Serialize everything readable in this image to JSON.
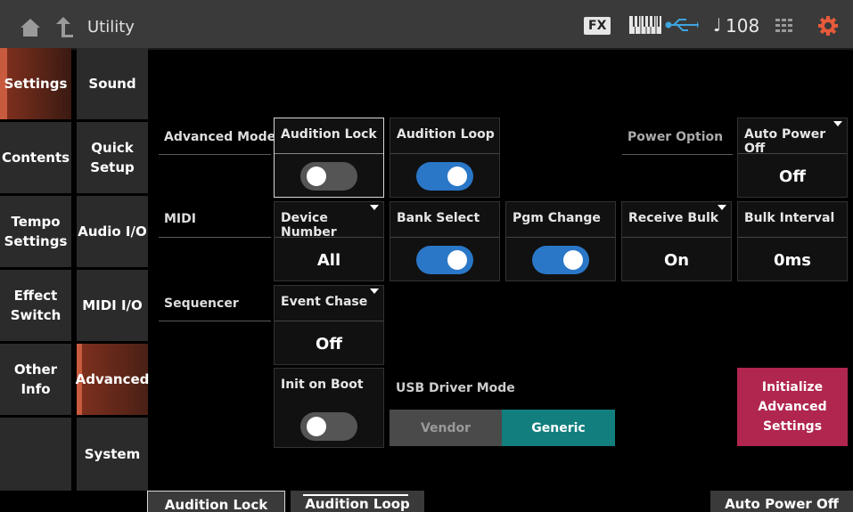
{
  "header": {
    "title": "Utility",
    "fx_label": "FX",
    "tempo": "♩08",
    "tempo_value": "108"
  },
  "nav_main": [
    {
      "label": "Settings"
    },
    {
      "label": "Contents"
    },
    {
      "label": "Tempo Settings"
    },
    {
      "label": "Effect Switch"
    },
    {
      "label": "Other Info"
    }
  ],
  "nav_sub": [
    {
      "label": "Sound"
    },
    {
      "label": "Quick Setup"
    },
    {
      "label": "Audio I/O"
    },
    {
      "label": "MIDI I/O"
    },
    {
      "label": "Advanced"
    },
    {
      "label": "System"
    }
  ],
  "rows": {
    "advanced_mode": "Advanced Mode",
    "midi": "MIDI",
    "sequencer": "Sequencer",
    "power_option": "Power Option",
    "usb_driver_mode": "USB Driver Mode"
  },
  "cells": {
    "audition_lock": {
      "label": "Audition Lock",
      "state": "off"
    },
    "audition_loop": {
      "label": "Audition Loop",
      "state": "on"
    },
    "auto_power_off": {
      "label": "Auto Power Off",
      "value": "Off"
    },
    "device_number": {
      "label": "Device Number",
      "value": "All"
    },
    "bank_select": {
      "label": "Bank Select",
      "state": "on"
    },
    "pgm_change": {
      "label": "Pgm Change",
      "state": "on"
    },
    "receive_bulk": {
      "label": "Receive Bulk",
      "value": "On"
    },
    "bulk_interval": {
      "label": "Bulk Interval",
      "value": "0ms"
    },
    "event_chase": {
      "label": "Event Chase",
      "value": "Off"
    },
    "init_on_boot": {
      "label": "Init on Boot",
      "state": "off"
    }
  },
  "usb_driver": {
    "options": [
      "Vendor",
      "Generic"
    ],
    "selected": "Generic"
  },
  "init_button": "Initialize Advanced Settings",
  "bottom_tabs": [
    "Audition Lock",
    "Audition Loop",
    "Auto Power Off"
  ],
  "colors": {
    "accent": "#c85a3e",
    "toggle_on": "#2a77c8",
    "generic": "#137e7e",
    "init": "#b0264e"
  }
}
